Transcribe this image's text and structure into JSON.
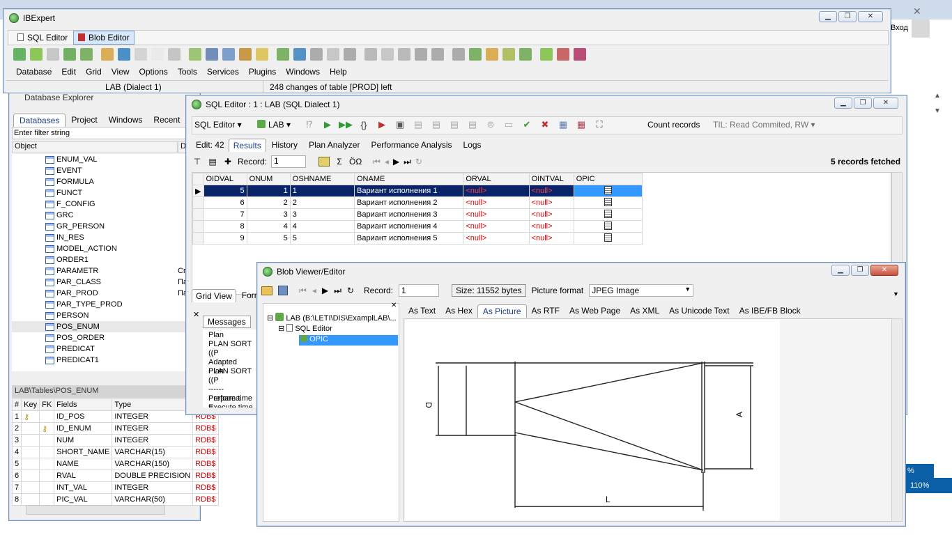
{
  "ibexpert": {
    "title": "IBExpert",
    "tabs": [
      "SQL Editor",
      "Blob Editor"
    ],
    "menu": [
      "Database",
      "Edit",
      "Grid",
      "View",
      "Options",
      "Tools",
      "Services",
      "Plugins",
      "Windows",
      "Help"
    ],
    "status_db": "LAB (Dialect 1)",
    "status_msg": "248 changes of table [PROD] left"
  },
  "explorer": {
    "title": "Database Explorer",
    "tabs": [
      "Databases",
      "Project",
      "Windows",
      "Recent"
    ],
    "filter_placeholder": "Enter filter string",
    "col_object": "Object",
    "col_d": "D",
    "items": [
      {
        "name": "ENUM_VAL",
        "d": ""
      },
      {
        "name": "EVENT",
        "d": ""
      },
      {
        "name": "FORMULA",
        "d": ""
      },
      {
        "name": "FUNCT",
        "d": ""
      },
      {
        "name": "F_CONFIG",
        "d": ""
      },
      {
        "name": "GRC",
        "d": ""
      },
      {
        "name": "GR_PERSON",
        "d": ""
      },
      {
        "name": "IN_RES",
        "d": ""
      },
      {
        "name": "MODEL_ACTION",
        "d": ""
      },
      {
        "name": "ORDER1",
        "d": ""
      },
      {
        "name": "PARAMETR",
        "d": "Сг"
      },
      {
        "name": "PAR_CLASS",
        "d": "Па"
      },
      {
        "name": "PAR_PROD",
        "d": "Па"
      },
      {
        "name": "PAR_TYPE_PROD",
        "d": ""
      },
      {
        "name": "PERSON",
        "d": ""
      },
      {
        "name": "POS_ENUM",
        "d": ""
      },
      {
        "name": "POS_ORDER",
        "d": ""
      },
      {
        "name": "PREDICAT",
        "d": ""
      },
      {
        "name": "PREDICAT1",
        "d": ""
      }
    ],
    "path": "LAB\\Tables\\POS_ENUM",
    "fields_headers": [
      "#",
      "Key",
      "FK",
      "Fields",
      "Type"
    ],
    "fields": [
      {
        "n": "1",
        "key": "pk",
        "fk": "",
        "name": "ID_POS",
        "type": "INTEGER",
        "extra": "RDB$"
      },
      {
        "n": "2",
        "key": "",
        "fk": "fk",
        "name": "ID_ENUM",
        "type": "INTEGER",
        "extra": "RDB$"
      },
      {
        "n": "3",
        "key": "",
        "fk": "",
        "name": "NUM",
        "type": "INTEGER",
        "extra": "RDB$"
      },
      {
        "n": "4",
        "key": "",
        "fk": "",
        "name": "SHORT_NAME",
        "type": "VARCHAR(15)",
        "extra": "RDB$"
      },
      {
        "n": "5",
        "key": "",
        "fk": "",
        "name": "NAME",
        "type": "VARCHAR(150)",
        "extra": "RDB$"
      },
      {
        "n": "6",
        "key": "",
        "fk": "",
        "name": "RVAL",
        "type": "DOUBLE PRECISION",
        "extra": "RDB$"
      },
      {
        "n": "7",
        "key": "",
        "fk": "",
        "name": "INT_VAL",
        "type": "INTEGER",
        "extra": "RDB$"
      },
      {
        "n": "8",
        "key": "",
        "fk": "",
        "name": "PIC_VAL",
        "type": "VARCHAR(50)",
        "extra": "RDB$"
      }
    ]
  },
  "sql_editor": {
    "title": "SQL Editor : 1 : LAB (SQL Dialect 1)",
    "editor_dropdown": "SQL Editor",
    "db_dropdown": "LAB",
    "count_records": "Count records",
    "til": "TIL: Read Commited, RW",
    "tabs": [
      "Edit: 42",
      "Results",
      "History",
      "Plan Analyzer",
      "Performance Analysis",
      "Logs"
    ],
    "record_label": "Record:",
    "record_value": "1",
    "fetched": "5 records fetched",
    "headers": [
      "OIDVAL",
      "ONUM",
      "OSHNAME",
      "ONAME",
      "ORVAL",
      "OINTVAL",
      "OPIC"
    ],
    "rows": [
      {
        "oidval": "5",
        "onum": "1",
        "oshname": "1",
        "oname": "Вариант исполнения 1",
        "orval": "<null>",
        "ointval": "<null>"
      },
      {
        "oidval": "6",
        "onum": "2",
        "oshname": "2",
        "oname": "Вариант исполнения 2",
        "orval": "<null>",
        "ointval": "<null>"
      },
      {
        "oidval": "7",
        "onum": "3",
        "oshname": "3",
        "oname": "Вариант исполнения 3",
        "orval": "<null>",
        "ointval": "<null>"
      },
      {
        "oidval": "8",
        "onum": "4",
        "oshname": "4",
        "oname": "Вариант исполнения 4",
        "orval": "<null>",
        "ointval": "<null>"
      },
      {
        "oidval": "9",
        "onum": "5",
        "oshname": "5",
        "oname": "Вариант исполнения 5",
        "orval": "<null>",
        "ointval": "<null>"
      }
    ],
    "bottom_tabs": [
      "Grid View",
      "Form"
    ],
    "messages_tab": "Messages",
    "messages": [
      "Plan",
      "PLAN SORT ((P",
      "",
      "Adapted Plan",
      "PLAN SORT ((P",
      "",
      "------ Performa",
      "Prepare time =",
      "Execute time ="
    ]
  },
  "blob": {
    "title": "Blob Viewer/Editor",
    "record_label": "Record:",
    "record_value": "1",
    "size": "Size: 11552 bytes",
    "format_label": "Picture format",
    "format_value": "JPEG Image",
    "tree": [
      "LAB (B:\\LETI\\DIS\\ExamplLAB\\...",
      "SQL Editor",
      "OPIC"
    ],
    "view_tabs": [
      "As Text",
      "As Hex",
      "As Picture",
      "As RTF",
      "As Web Page",
      "As XML",
      "As Unicode Text",
      "As IBE/FB Block"
    ],
    "drawing_labels": {
      "d": "D",
      "a": "A",
      "l": "L"
    }
  },
  "background": {
    "login": "Вход",
    "zoom": "110%",
    "percent": "%"
  }
}
